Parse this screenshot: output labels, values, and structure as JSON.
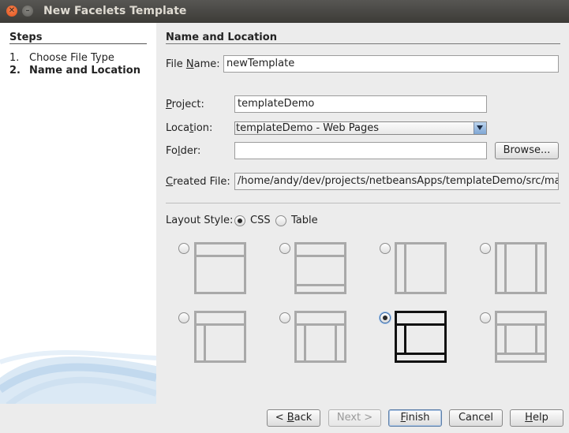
{
  "window": {
    "title": "New Facelets Template"
  },
  "steps": {
    "heading": "Steps",
    "items": [
      {
        "num": "1.",
        "label": "Choose File Type"
      },
      {
        "num": "2.",
        "label": "Name and Location"
      }
    ]
  },
  "form": {
    "section_title": "Name and Location",
    "file_name": {
      "label_pre": "File ",
      "label_key": "N",
      "label_post": "ame:",
      "value": "newTemplate"
    },
    "project": {
      "label_key": "P",
      "label_post": "roject:",
      "value": "templateDemo"
    },
    "location": {
      "label_pre": "Loca",
      "label_key": "t",
      "label_post": "ion:",
      "value": "templateDemo - Web Pages"
    },
    "folder": {
      "label_pre": "Fo",
      "label_key": "l",
      "label_post": "der:",
      "value": ""
    },
    "browse": {
      "label": "Browse..."
    },
    "created_file": {
      "label_key": "C",
      "label_post": "reated File:",
      "value": "/home/andy/dev/projects/netbeansApps/templateDemo/src/main,"
    }
  },
  "layout_style": {
    "label": "Layout Style:",
    "options": [
      "CSS",
      "Table"
    ],
    "selected": "CSS",
    "templates_selected_index": 6
  },
  "buttons": {
    "back": {
      "key": "B",
      "post": "ack",
      "prefix": "< "
    },
    "next": {
      "label": "Next >"
    },
    "finish": {
      "key": "F",
      "post": "inish"
    },
    "cancel": {
      "label": "Cancel"
    },
    "help": {
      "key": "H",
      "post": "elp"
    }
  },
  "colors": {
    "title_bar": "#3c3b37",
    "close_button": "#e2511d",
    "selected_template": "#111111",
    "template_outline": "#a9a9a9"
  }
}
